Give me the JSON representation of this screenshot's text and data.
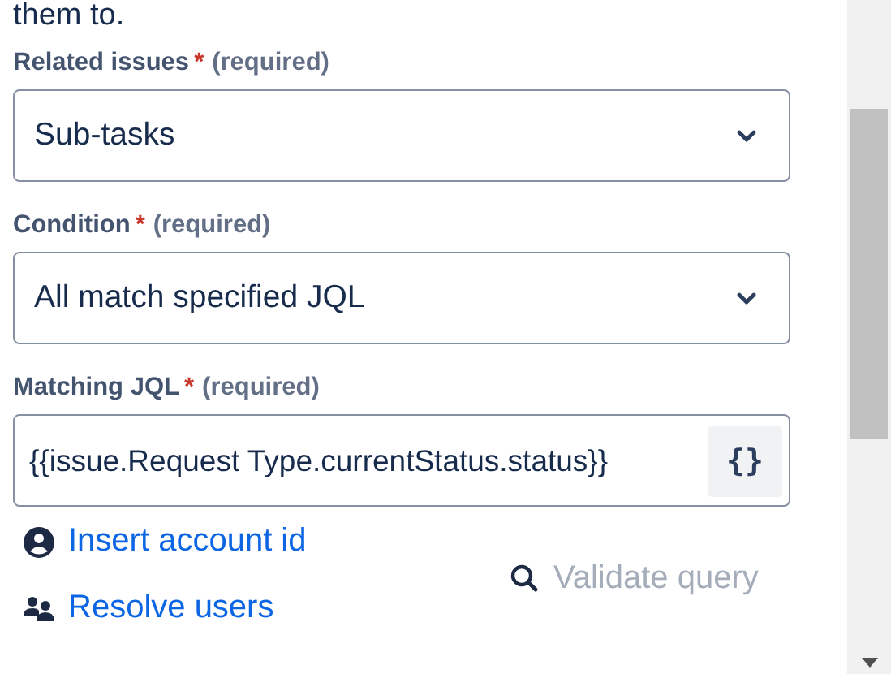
{
  "intro_text": "them to.",
  "fields": [
    {
      "kind": "select",
      "label": "Related issues",
      "required_mark": "*",
      "required_note": "(required)",
      "value": "Sub-tasks"
    },
    {
      "kind": "select",
      "label": "Condition",
      "required_mark": "*",
      "required_note": "(required)",
      "value": "All match specified JQL"
    },
    {
      "kind": "jql",
      "label": "Matching JQL",
      "required_mark": "*",
      "required_note": "(required)",
      "value": "{{issue.Request Type.currentStatus.status}}",
      "button": "{}"
    }
  ],
  "links": [
    {
      "kind": "account",
      "label": "Insert account id"
    },
    {
      "kind": "users",
      "label": "Resolve users"
    }
  ],
  "validate": {
    "label": "Validate query",
    "disabled": true
  }
}
